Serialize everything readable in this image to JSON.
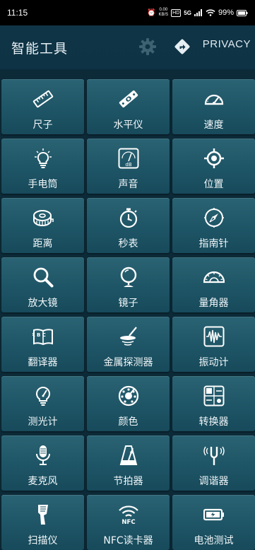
{
  "status_bar": {
    "time": "11:15",
    "net_speed_value": "0.00",
    "net_speed_unit": "KB/S",
    "chip": "HD",
    "signal_label": "5G",
    "battery": "99%"
  },
  "header": {
    "title": "智能工具",
    "privacy_label": "PRIVACY"
  },
  "tools": [
    {
      "label": "尺子",
      "icon": "ruler-icon"
    },
    {
      "label": "水平仪",
      "icon": "spirit-level-icon"
    },
    {
      "label": "速度",
      "icon": "speedometer-icon"
    },
    {
      "label": "手电筒",
      "icon": "lightbulb-icon"
    },
    {
      "label": "声音",
      "icon": "sound-meter-icon",
      "icon_text": "dB"
    },
    {
      "label": "位置",
      "icon": "location-target-icon"
    },
    {
      "label": "距离",
      "icon": "tape-measure-icon"
    },
    {
      "label": "秒表",
      "icon": "stopwatch-icon"
    },
    {
      "label": "指南针",
      "icon": "compass-icon"
    },
    {
      "label": "放大镜",
      "icon": "magnifier-icon"
    },
    {
      "label": "镜子",
      "icon": "mirror-icon"
    },
    {
      "label": "量角器",
      "icon": "protractor-icon"
    },
    {
      "label": "翻译器",
      "icon": "translator-icon",
      "icon_text": "A B C"
    },
    {
      "label": "金属探测器",
      "icon": "metal-detector-icon"
    },
    {
      "label": "振动计",
      "icon": "vibration-meter-icon"
    },
    {
      "label": "测光计",
      "icon": "light-meter-icon"
    },
    {
      "label": "颜色",
      "icon": "color-picker-icon"
    },
    {
      "label": "转换器",
      "icon": "unit-converter-icon"
    },
    {
      "label": "麦克风",
      "icon": "microphone-icon"
    },
    {
      "label": "节拍器",
      "icon": "metronome-icon"
    },
    {
      "label": "调谐器",
      "icon": "tuning-fork-icon"
    },
    {
      "label": "扫描仪",
      "icon": "barcode-scanner-icon"
    },
    {
      "label": "NFC读卡器",
      "icon": "nfc-icon",
      "icon_text": "NFC"
    },
    {
      "label": "电池测试",
      "icon": "battery-icon"
    }
  ]
}
